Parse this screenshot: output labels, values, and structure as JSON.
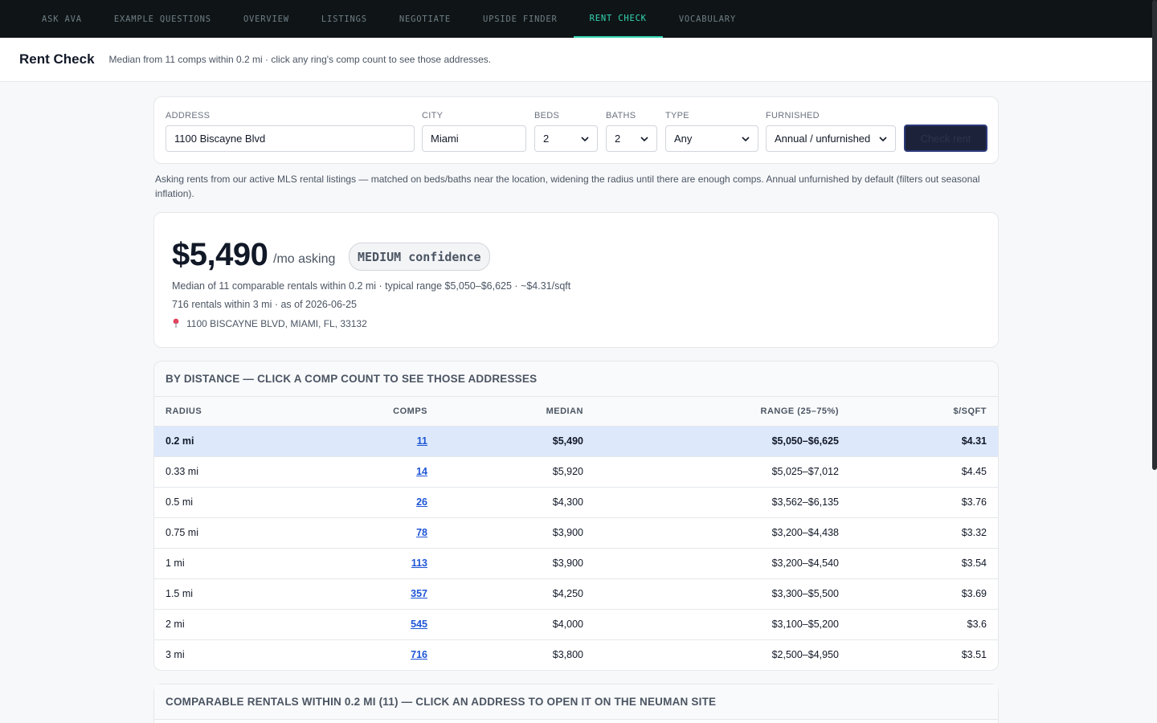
{
  "nav": {
    "tabs": [
      "ASK AVA",
      "EXAMPLE QUESTIONS",
      "OVERVIEW",
      "LISTINGS",
      "NEGOTIATE",
      "UPSIDE FINDER",
      "RENT CHECK",
      "VOCABULARY"
    ],
    "active_index": 6
  },
  "header": {
    "title": "Rent Check",
    "subtitle": "Median from 11 comps within 0.2 mi · click any ring's comp count to see those addresses."
  },
  "form": {
    "address_label": "ADDRESS",
    "address_value": "1100 Biscayne Blvd",
    "city_label": "CITY",
    "city_value": "Miami",
    "beds_label": "BEDS",
    "beds_value": "2",
    "baths_label": "BATHS",
    "baths_value": "2",
    "type_label": "TYPE",
    "type_value": "Any",
    "furnished_label": "FURNISHED",
    "furnished_value": "Annual / unfurnished",
    "submit_label": "Check rent"
  },
  "note": "Asking rents from our active MLS rental listings — matched on beds/baths near the location, widening the radius until there are enough comps. Annual unfurnished by default (filters out seasonal inflation).",
  "result": {
    "price": "$5,490",
    "unit": "/mo asking",
    "confidence": "MEDIUM confidence",
    "line1": "Median of 11 comparable rentals within 0.2 mi · typical range $5,050–$6,625 · ~$4.31/sqft",
    "line2": "716 rentals within 3 mi · as of 2026-06-25",
    "location": "1100 BISCAYNE BLVD, MIAMI, FL, 33132"
  },
  "distance_table": {
    "caption": "BY DISTANCE — CLICK A COMP COUNT TO SEE THOSE ADDRESSES",
    "headers": {
      "radius": "RADIUS",
      "comps": "COMPS",
      "median": "MEDIAN",
      "range": "RANGE (25–75%)",
      "sqft": "$/SQFT"
    },
    "highlight_index": 0,
    "rows": [
      {
        "radius": "0.2 mi",
        "comps": "11",
        "median": "$5,490",
        "range": "$5,050–$6,625",
        "sqft": "$4.31"
      },
      {
        "radius": "0.33 mi",
        "comps": "14",
        "median": "$5,920",
        "range": "$5,025–$7,012",
        "sqft": "$4.45"
      },
      {
        "radius": "0.5 mi",
        "comps": "26",
        "median": "$4,300",
        "range": "$3,562–$6,135",
        "sqft": "$3.76"
      },
      {
        "radius": "0.75 mi",
        "comps": "78",
        "median": "$3,900",
        "range": "$3,200–$4,438",
        "sqft": "$3.32"
      },
      {
        "radius": "1 mi",
        "comps": "113",
        "median": "$3,900",
        "range": "$3,200–$4,540",
        "sqft": "$3.54"
      },
      {
        "radius": "1.5 mi",
        "comps": "357",
        "median": "$4,250",
        "range": "$3,300–$5,500",
        "sqft": "$3.69"
      },
      {
        "radius": "2 mi",
        "comps": "545",
        "median": "$4,000",
        "range": "$3,100–$5,200",
        "sqft": "$3.6"
      },
      {
        "radius": "3 mi",
        "comps": "716",
        "median": "$3,800",
        "range": "$2,500–$4,950",
        "sqft": "$3.51"
      }
    ]
  },
  "comparables": {
    "caption": "COMPARABLE RENTALS WITHIN 0.2 MI (11) — CLICK AN ADDRESS TO OPEN IT ON THE NEUMAN SITE"
  }
}
